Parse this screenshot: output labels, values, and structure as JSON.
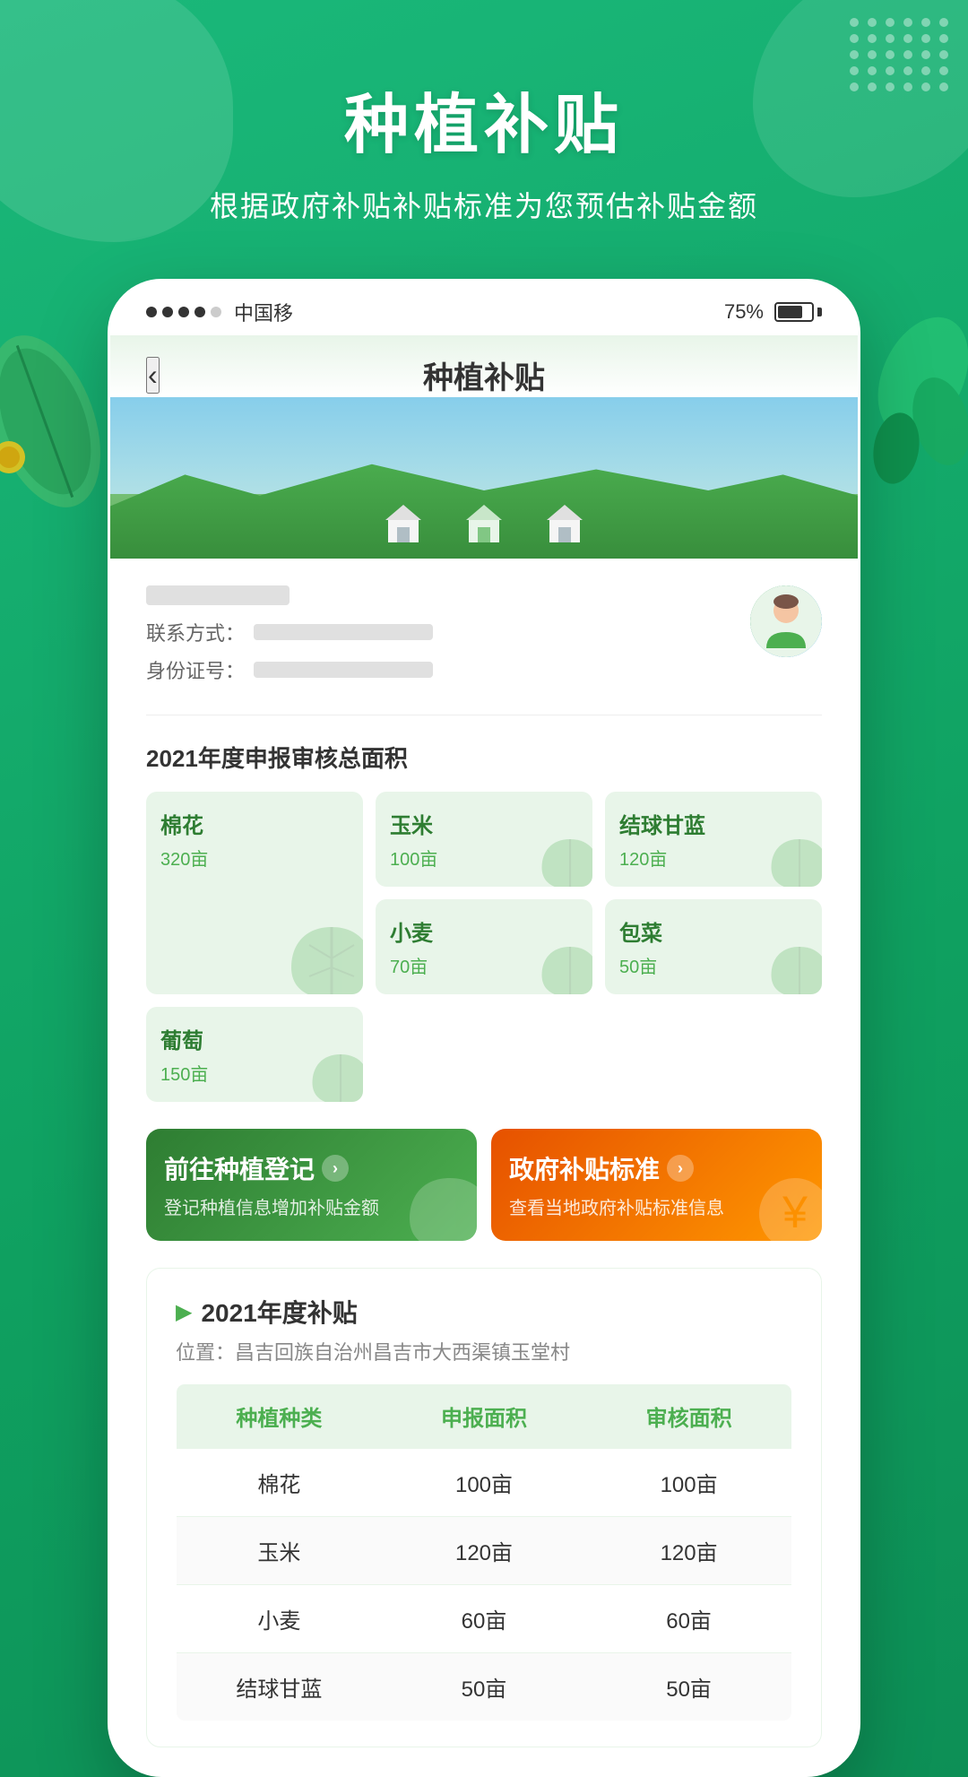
{
  "app": {
    "main_title": "种植补贴",
    "sub_title": "根据政府补贴补贴标准为您预估补贴金额"
  },
  "status_bar": {
    "carrier": "中国移",
    "battery_percent": "75%"
  },
  "header": {
    "back_icon": "‹",
    "title": "种植补贴"
  },
  "user": {
    "contact_label": "联系方式：",
    "id_label": "身份证号："
  },
  "area_summary": {
    "title": "2021年度申报审核总面积"
  },
  "crops": [
    {
      "name": "棉花",
      "area": "320亩",
      "large": true
    },
    {
      "name": "玉米",
      "area": "100亩",
      "large": false
    },
    {
      "name": "结球甘蓝",
      "area": "120亩",
      "large": false
    },
    {
      "name": "小麦",
      "area": "70亩",
      "large": false
    },
    {
      "name": "包菜",
      "area": "50亩",
      "large": false
    },
    {
      "name": "葡萄",
      "area": "150亩",
      "large": false
    }
  ],
  "actions": [
    {
      "title": "前往种植登记",
      "desc": "登记种植信息增加补贴金额",
      "type": "green"
    },
    {
      "title": "政府补贴标准",
      "desc": "查看当地政府补贴标准信息",
      "type": "orange"
    }
  ],
  "subsidy": {
    "title": "2021年度补贴",
    "location": "位置：昌吉回族自治州昌吉市大西渠镇玉堂村",
    "table_headers": [
      "种植种类",
      "申报面积",
      "审核面积"
    ],
    "table_rows": [
      [
        "棉花",
        "100亩",
        "100亩"
      ],
      [
        "玉米",
        "120亩",
        "120亩"
      ],
      [
        "小麦",
        "60亩",
        "60亩"
      ],
      [
        "结球甘蓝",
        "50亩",
        "50亩"
      ]
    ]
  }
}
